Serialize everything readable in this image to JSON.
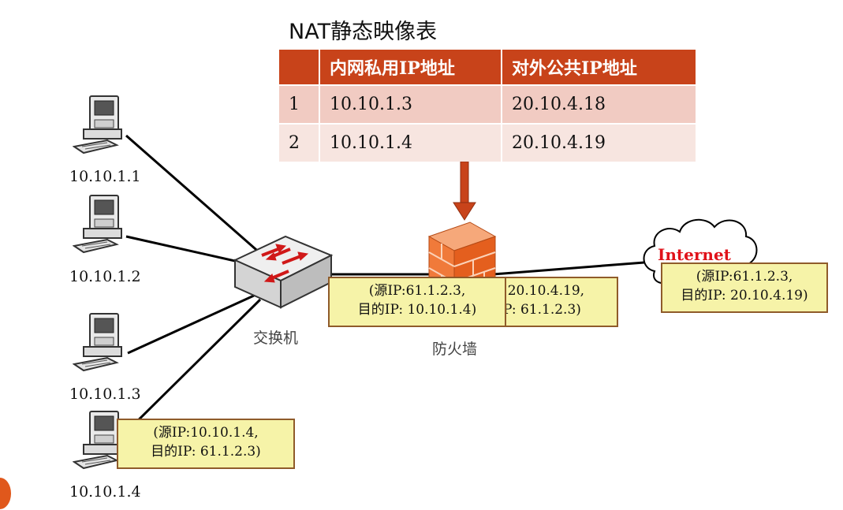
{
  "table": {
    "title": "NAT静态映像表",
    "headers": [
      "",
      "内网私用IP地址",
      "对外公共IP地址"
    ],
    "rows": [
      [
        "1",
        "10.10.1.3",
        "20.10.4.18"
      ],
      [
        "2",
        "10.10.1.4",
        "20.10.4.19"
      ]
    ]
  },
  "hosts": [
    "10.10.1.1",
    "10.10.1.2",
    "10.10.1.3",
    "10.10.1.4"
  ],
  "devices": {
    "switch_label": "交换机",
    "firewall_label": "防火墙",
    "internet_label": "Internet"
  },
  "notes": {
    "host_packet": [
      "(源IP:10.10.1.4,",
      "目的IP: 61.1.2.3)"
    ],
    "firewall_out_partial": [
      ":20.10.4.19,",
      "P: 61.1.2.3)"
    ],
    "internet_packet": [
      "(源IP:61.1.2.3,",
      "目的IP: 20.10.4.19)"
    ],
    "firewall_in_packet": [
      "(源IP:61.1.2.3,",
      "目的IP: 10.10.1.4)"
    ]
  },
  "colors": {
    "header": "#c8431a",
    "row_odd": "#f1cbc2",
    "row_even": "#f7e5e0",
    "note_fill": "#f6f3a8",
    "note_border": "#8f5b2a",
    "arrow": "#c8431a",
    "firewall": "#f07a3a",
    "internet_text": "#e0121a"
  },
  "icons": [
    "computer-icon",
    "switch-icon",
    "firewall-icon",
    "cloud-icon",
    "down-arrow-icon"
  ]
}
